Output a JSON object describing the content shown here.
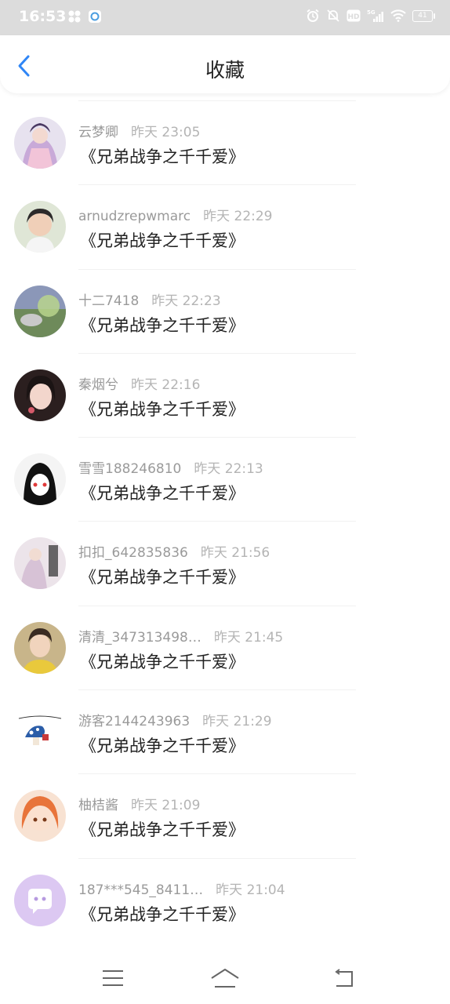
{
  "status_bar": {
    "time": "16:53",
    "battery": "41",
    "network": "5G",
    "hd_label": "HD",
    "icons": [
      "apps-icon",
      "browser-icon",
      "alarm-icon",
      "mute-icon",
      "hd-icon",
      "signal-icon",
      "wifi-icon",
      "battery-icon"
    ]
  },
  "header": {
    "title": "收藏",
    "back_icon": "chevron-left-icon",
    "accent_color": "#2f86f6"
  },
  "items": [
    {
      "user": "云梦卿",
      "time": "昨天 23:05",
      "book": "《兄弟战争之千千爱》"
    },
    {
      "user": "arnudzrepwmarc",
      "time": "昨天 22:29",
      "book": "《兄弟战争之千千爱》"
    },
    {
      "user": "十二7418",
      "time": "昨天 22:23",
      "book": "《兄弟战争之千千爱》"
    },
    {
      "user": "秦烟兮",
      "time": "昨天 22:16",
      "book": "《兄弟战争之千千爱》"
    },
    {
      "user": "雪雪188246810",
      "time": "昨天 22:13",
      "book": "《兄弟战争之千千爱》"
    },
    {
      "user": "扣扣_642835836",
      "time": "昨天 21:56",
      "book": "《兄弟战争之千千爱》"
    },
    {
      "user": "清清_347313498…",
      "time": "昨天 21:45",
      "book": "《兄弟战争之千千爱》"
    },
    {
      "user": "游客2144243963",
      "time": "昨天 21:29",
      "book": "《兄弟战争之千千爱》"
    },
    {
      "user": "柚桔酱",
      "time": "昨天 21:09",
      "book": "《兄弟战争之千千爱》"
    },
    {
      "user": "187***545_8411…",
      "time": "昨天 21:04",
      "book": "《兄弟战争之千千爱》"
    }
  ],
  "nav_bar": {
    "icons": [
      "menu-icon",
      "home-icon",
      "back-icon"
    ]
  }
}
